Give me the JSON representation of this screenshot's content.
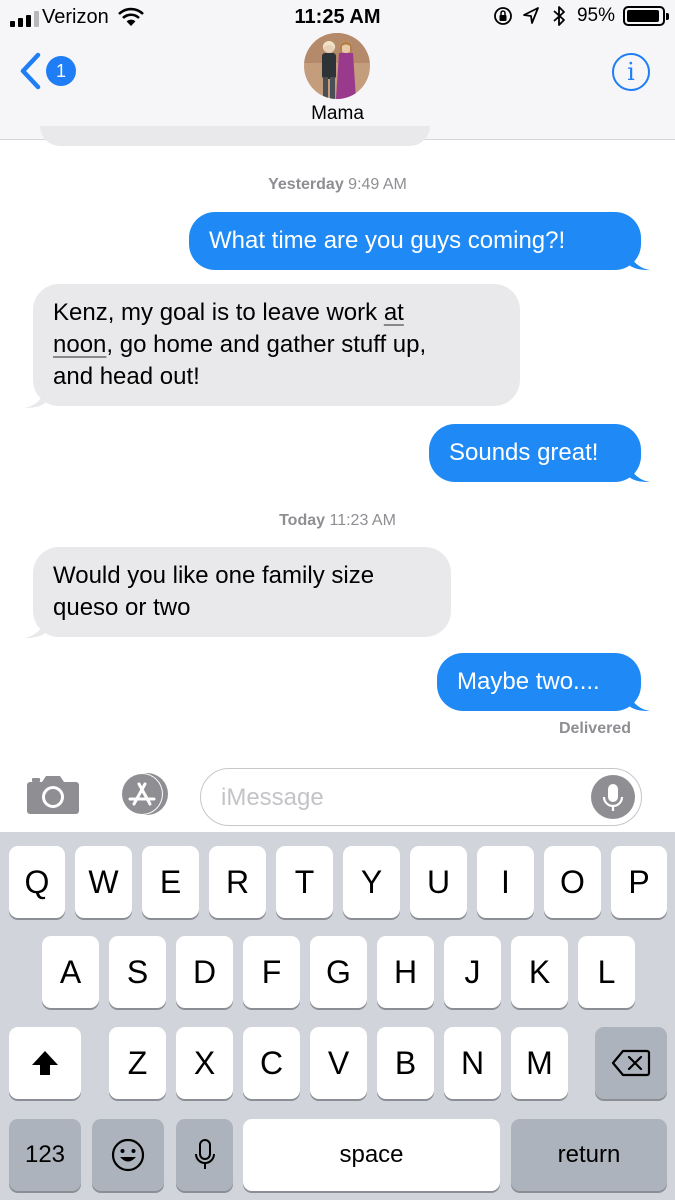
{
  "status_bar": {
    "carrier": "Verizon",
    "time": "11:25 AM",
    "battery_percent": "95%",
    "battery_level": 0.95,
    "icons": [
      "signal-icon",
      "wifi-icon",
      "rotation-lock-icon",
      "location-icon",
      "bluetooth-icon",
      "battery-icon"
    ]
  },
  "header": {
    "back_badge": "1",
    "contact_name": "Mama",
    "info_label": "i"
  },
  "messages": [
    {
      "type": "timestamp",
      "day": "Yesterday",
      "time": "9:49 AM"
    },
    {
      "type": "sent",
      "text": "What time are you guys coming?!"
    },
    {
      "type": "received",
      "lines": [
        "Kenz, my goal is to leave work ",
        "at",
        "noon",
        ", go home and gather stuff up,",
        "and head out!"
      ]
    },
    {
      "type": "sent",
      "text": "Sounds great!"
    },
    {
      "type": "timestamp",
      "day": "Today",
      "time": "11:23 AM"
    },
    {
      "type": "received",
      "lines": [
        "Would you like one family size",
        "queso or two"
      ]
    },
    {
      "type": "sent",
      "text": "Maybe two...."
    }
  ],
  "delivered_label": "Delivered",
  "composer": {
    "placeholder": "iMessage",
    "value": ""
  },
  "keyboard": {
    "row1": [
      "Q",
      "W",
      "E",
      "R",
      "T",
      "Y",
      "U",
      "I",
      "O",
      "P"
    ],
    "row2": [
      "A",
      "S",
      "D",
      "F",
      "G",
      "H",
      "J",
      "K",
      "L"
    ],
    "row3": [
      "Z",
      "X",
      "C",
      "V",
      "B",
      "N",
      "M"
    ],
    "numbers_key": "123",
    "space_key": "space",
    "return_key": "return"
  },
  "colors": {
    "accent": "#1f7ef6",
    "sent_bubble": "#1f8af5",
    "received_bubble": "#e9e9eb",
    "keyboard_bg": "#d1d4da"
  }
}
